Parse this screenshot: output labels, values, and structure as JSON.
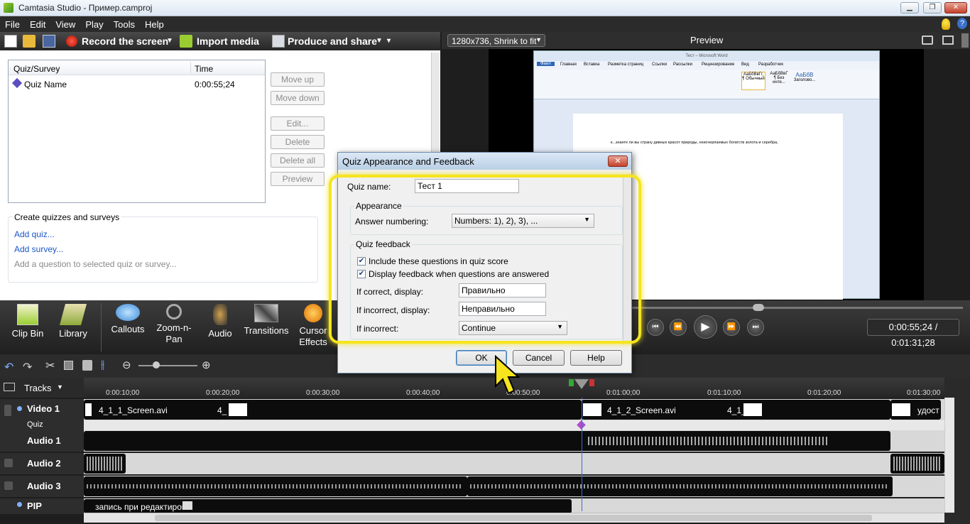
{
  "window": {
    "title": "Camtasia Studio - Пример.camproj",
    "controls": [
      "minimize",
      "maximize",
      "close"
    ]
  },
  "menu": [
    "File",
    "Edit",
    "View",
    "Play",
    "Tools",
    "Help"
  ],
  "toolbar": {
    "record": "Record the screen",
    "import": "Import media",
    "produce": "Produce and share"
  },
  "quiz_panel": {
    "headers": [
      "Quiz/Survey",
      "Time"
    ],
    "rows": [
      {
        "name": "Quiz Name",
        "time": "0:00:55;24"
      }
    ],
    "side_buttons": [
      "Move up",
      "Move down",
      "Edit...",
      "Delete",
      "Delete all",
      "Preview"
    ],
    "create_title": "Create quizzes and surveys",
    "add_quiz": "Add quiz...",
    "add_survey": "Add survey...",
    "add_question": "Add a question to selected quiz or survey..."
  },
  "preview": {
    "size_select": "1280x736, Shrink to fit",
    "title": "Preview",
    "doc_title": "Тест – Microsoft Word",
    "doc_tabs": [
      "Файл",
      "Главная",
      "Вставка",
      "Разметка страниц",
      "Ссылки",
      "Рассылки",
      "Рецензирование",
      "Вид",
      "Разработчик"
    ],
    "doc_styles": [
      "АаБбВвГг,",
      "АаБбВвГ",
      "АаБбВ"
    ],
    "doc_style_names": [
      "¶ Обычный",
      "¶ Без инте...",
      "Заголово..."
    ],
    "doc_text": "к...знаете ли вы страну дивных красот природы, неисчерпаемых богатств золота и серебра,",
    "time": "0:00:55;24 / 0:01:31;28"
  },
  "tools": [
    {
      "label": "Clip Bin",
      "icon": "clip-bin-icon"
    },
    {
      "label": "Library",
      "icon": "library-icon"
    },
    {
      "label": "Callouts",
      "icon": "callouts-icon"
    },
    {
      "label": "Zoom-n-Pan",
      "icon": "zoom-icon"
    },
    {
      "label": "Audio",
      "icon": "audio-icon"
    },
    {
      "label": "Transitions",
      "icon": "transitions-icon"
    },
    {
      "label": "Cursor Effects",
      "icon": "cursor-effects-icon"
    }
  ],
  "timeline": {
    "tracks_label": "Tracks",
    "ruler": [
      "0:00:10;00",
      "0:00:20;00",
      "0:00:30;00",
      "0:00:40;00",
      "0:00:50;00",
      "0:01:00;00",
      "0:01:10;00",
      "0:01:20;00",
      "0:01:30;00"
    ],
    "tracks": [
      "Video 1",
      "Quiz",
      "Audio 1",
      "Audio 2",
      "Audio 3",
      "PIP"
    ],
    "clips": {
      "v1a": "4_1_1_Screen.avi",
      "v1b": "4_",
      "v1c": "4_1_2_Screen.avi",
      "v1d": "4_1_",
      "v1e": "удост",
      "pip": "запись при редактиров"
    }
  },
  "dialog": {
    "title": "Quiz Appearance and Feedback",
    "quiz_name_label": "Quiz name:",
    "quiz_name_value": "Тест 1",
    "appearance_label": "Appearance",
    "numbering_label": "Answer numbering:",
    "numbering_value": "Numbers: 1), 2), 3), ...",
    "feedback_label": "Quiz feedback",
    "include_label": "Include these questions in quiz score",
    "display_label": "Display feedback when questions are answered",
    "correct_label": "If correct, display:",
    "correct_value": "Правильно",
    "incorrect_label": "If incorrect, display:",
    "incorrect_value": "Неправильно",
    "ifincorrect_label": "If incorrect:",
    "ifincorrect_value": "Continue",
    "ok": "OK",
    "cancel": "Cancel",
    "help": "Help"
  }
}
